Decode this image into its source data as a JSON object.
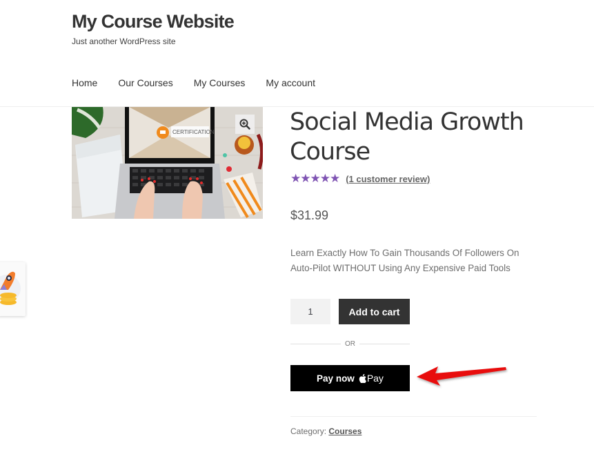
{
  "site": {
    "title": "My Course Website",
    "tagline": "Just another WordPress site"
  },
  "nav": {
    "items": [
      {
        "label": "Home"
      },
      {
        "label": "Our Courses"
      },
      {
        "label": "My Courses"
      },
      {
        "label": "My account"
      }
    ]
  },
  "product": {
    "image_alt": "Laptop with certification screen",
    "image_screen_text": "CERTIFICATION",
    "title": "Social Media Growth Course",
    "rating": {
      "value": 5,
      "max": 5,
      "review_link": "(1 customer review)"
    },
    "price": "$31.99",
    "description": "Learn Exactly How To Gain Thousands Of Followers On Auto-Pilot WITHOUT Using Any Expensive Paid Tools",
    "quantity": "1",
    "add_to_cart_label": "Add to cart",
    "or_label": "OR",
    "pay_now_label": "Pay now",
    "apple_pay_label": "Pay",
    "category_label": "Category:",
    "category_value": "Courses"
  },
  "colors": {
    "star": "#7f54b3",
    "button_dark": "#333333",
    "pay_button": "#000000",
    "annotation_arrow": "#e8110f"
  },
  "icons": {
    "zoom": "magnifier-plus-icon",
    "apple": "apple-logo-icon",
    "widget": "rocket-coins-icon"
  }
}
